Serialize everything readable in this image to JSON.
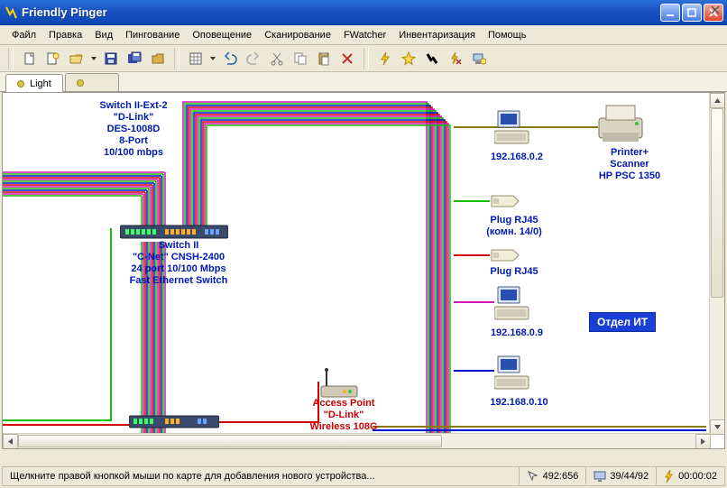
{
  "window": {
    "title": "Friendly Pinger"
  },
  "menu": [
    "Файл",
    "Правка",
    "Вид",
    "Пингование",
    "Оповещение",
    "Сканирование",
    "FWatcher",
    "Инвентаризация",
    "Помощь"
  ],
  "tabs": [
    {
      "label": "Light",
      "active": true
    },
    {
      "label": "",
      "active": false
    }
  ],
  "map": {
    "switch_ext2": "Switch II-Ext-2\n\"D-Link\"\nDES-1008D\n8-Port\n10/100 mbps",
    "switch2": "Switch II\n\"C-Net\"  CNSH-2400\n24 port 10/100 Mbps\nFast Ethernet Switch",
    "access_point": "Access Point\n\"D-Link\"\nWireless 108G",
    "ip1": "192.168.0.2",
    "plug1": "Plug RJ45\n(комн. 14/0)",
    "plug2": "Plug RJ45",
    "ip2": "192.168.0.9",
    "ip3": "192.168.0.10",
    "printer": "Printer+\nScanner\nHP PSC 1350",
    "dept_box": "Отдел ИТ"
  },
  "status": {
    "hint": "Щелкните правой кнопкой мыши по карте для добавления нового устройства...",
    "coords": "492:656",
    "counts": "39/44/92",
    "time": "00:00:02"
  },
  "colors": {
    "wire_bundle": [
      "#d414b8",
      "#14c100",
      "#0013d1",
      "#d40000",
      "#d414b8",
      "#14c100",
      "#0013d1",
      "#d40000",
      "#d414b8",
      "#14c100",
      "#0013d1",
      "#d40000",
      "#d414b8",
      "#14c100"
    ]
  }
}
